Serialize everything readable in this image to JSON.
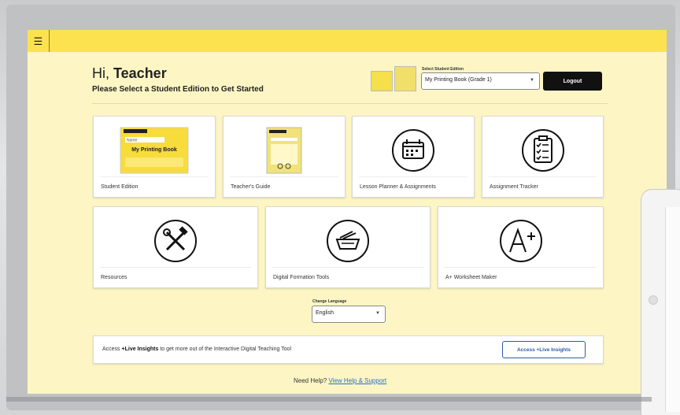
{
  "header": {
    "menu_icon": "hamburger-icon",
    "greeting_prefix": "Hi, ",
    "greeting_name": "Teacher",
    "subtitle": "Please Select a Student Edition to Get Started"
  },
  "edition_select": {
    "label": "Select Student Edition",
    "value": "My Printing Book (Grade 1)"
  },
  "logout_label": "Logout",
  "cards_row1": [
    {
      "label": "Student Edition",
      "icon": "student-edition-book-thumbnail"
    },
    {
      "label": "Teacher's Guide",
      "icon": "teachers-guide-book-thumbnail"
    },
    {
      "label": "Lesson Planner & Assignments",
      "icon": "calendar-icon"
    },
    {
      "label": "Assignment Tracker",
      "icon": "clipboard-checklist-icon"
    }
  ],
  "cards_row2": [
    {
      "label": "Resources",
      "icon": "wrench-hammer-icon"
    },
    {
      "label": "Digital Formation Tools",
      "icon": "tray-tools-icon"
    },
    {
      "label": "A+ Worksheet Maker",
      "icon": "a-plus-icon"
    }
  ],
  "book_cover": {
    "title": "My Printing Book",
    "name_field": "Name:"
  },
  "language": {
    "label": "Change Language",
    "value": "English"
  },
  "insights": {
    "text_before": "Access ",
    "text_bold": "+Live Insights",
    "text_after": " to get more out of the Interactive Digital Teaching Tool",
    "button_label": "Access +Live Insights"
  },
  "help": {
    "prefix": "Need Help? ",
    "link_label": "View Help & Support"
  },
  "colors": {
    "topbar": "#fde24f",
    "background": "#fdf6c4",
    "link": "#2a6fc9",
    "button_dark": "#111111"
  }
}
